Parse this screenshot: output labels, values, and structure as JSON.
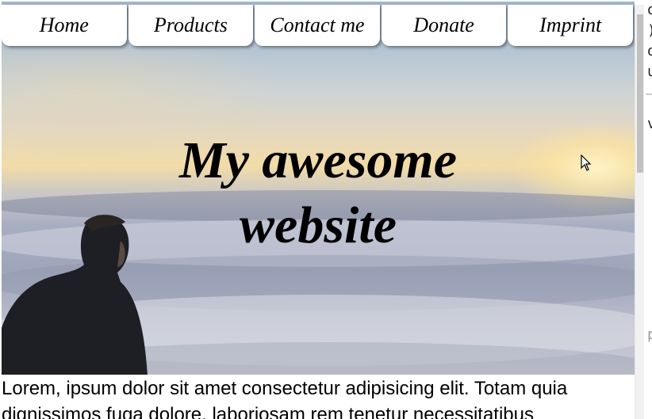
{
  "nav": {
    "items": [
      {
        "label": "Home"
      },
      {
        "label": "Products"
      },
      {
        "label": "Contact me"
      },
      {
        "label": "Donate"
      },
      {
        "label": "Imprint"
      }
    ]
  },
  "hero": {
    "title_line1": "My awesome",
    "title_line2": "website"
  },
  "content": {
    "paragraph": "Lorem, ipsum dolor sit amet consectetur adipisicing elit. Totam quia dignissimos fuga dolore, laboriosam rem tenetur necessitatibus"
  },
  "side_panel": {
    "lines": [
      "o",
      ")",
      "o",
      "u",
      "v",
      "p"
    ]
  },
  "colors": {
    "nav_background": "#ffffff",
    "text": "#000000",
    "sky_top": "#9fb7cf",
    "sunset": "#f2dca7",
    "clouds": "#a8aec2"
  }
}
